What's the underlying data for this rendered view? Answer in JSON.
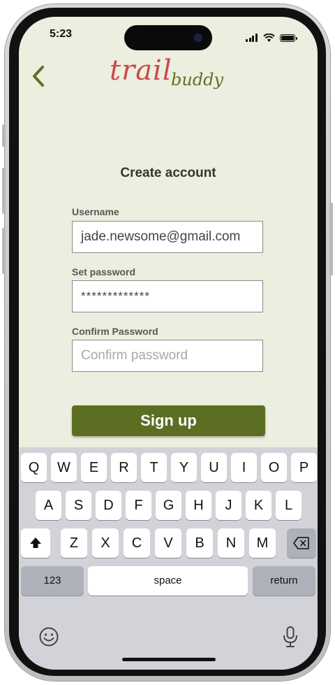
{
  "status": {
    "time": "5:23"
  },
  "logo": {
    "part1": "trail",
    "part2": "buddy"
  },
  "form": {
    "title": "Create account",
    "username_label": "Username",
    "username_value": "jade.newsome@gmail.com",
    "password_label": "Set password",
    "password_value": "*************",
    "confirm_label": "Confirm Password",
    "confirm_placeholder": "Confirm password",
    "submit_label": "Sign up"
  },
  "keyboard": {
    "row1": [
      "Q",
      "W",
      "E",
      "R",
      "T",
      "Y",
      "U",
      "I",
      "O",
      "P"
    ],
    "row2": [
      "A",
      "S",
      "D",
      "F",
      "G",
      "H",
      "J",
      "K",
      "L"
    ],
    "row3": [
      "Z",
      "X",
      "C",
      "V",
      "B",
      "N",
      "M"
    ],
    "numbers_label": "123",
    "space_label": "space",
    "return_label": "return",
    "icons": [
      "shift-icon",
      "backspace-icon",
      "emoji-icon",
      "microphone-icon"
    ]
  },
  "colors": {
    "background": "#eceedf",
    "accent": "#5c6e22",
    "logo_red": "#c94a4a",
    "logo_green": "#5b7324"
  }
}
